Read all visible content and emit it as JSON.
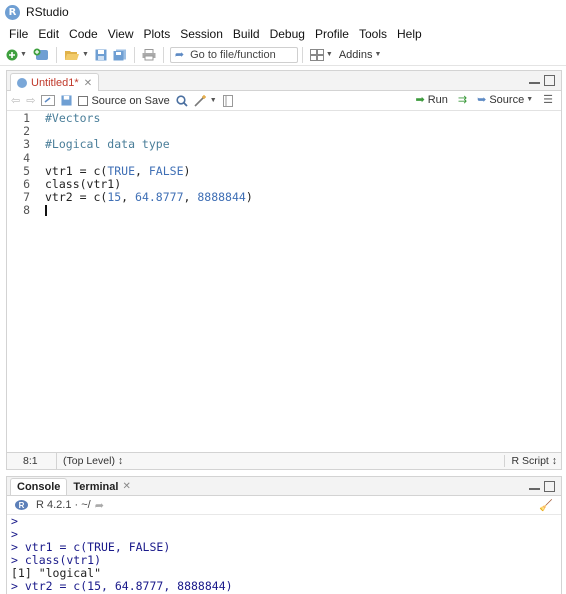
{
  "window": {
    "title": "RStudio",
    "logo_letter": "R"
  },
  "menu": [
    "File",
    "Edit",
    "Code",
    "View",
    "Plots",
    "Session",
    "Build",
    "Debug",
    "Profile",
    "Tools",
    "Help"
  ],
  "toolbar": {
    "goto_placeholder": "Go to file/function",
    "addins_label": "Addins"
  },
  "editor": {
    "tab_label": "Untitled1*",
    "source_on_save_label": "Source on Save",
    "run_label": "Run",
    "source_label": "Source",
    "lines": [
      {
        "num": "1",
        "text": "#Vectors"
      },
      {
        "num": "2",
        "text": ""
      },
      {
        "num": "3",
        "text": "#Logical data type"
      },
      {
        "num": "4",
        "text": ""
      },
      {
        "num": "5",
        "text": "vtr1 = c(TRUE, FALSE)"
      },
      {
        "num": "6",
        "text": "class(vtr1)"
      },
      {
        "num": "7",
        "text": "vtr2 = c(15, 64.8777, 8888844)"
      },
      {
        "num": "8",
        "text": ""
      }
    ],
    "status": {
      "position": "8:1",
      "scope": "(Top Level) ↕",
      "file_type": "R Script ↕"
    }
  },
  "console": {
    "tabs": [
      {
        "label": "Console"
      },
      {
        "label": "Terminal"
      }
    ],
    "r_version": "R 4.2.1 · ~/",
    "lines": [
      {
        "text": ">",
        "kind": "prompt"
      },
      {
        "text": ">",
        "kind": "prompt"
      },
      {
        "text": "> vtr1 = c(TRUE, FALSE)",
        "kind": "prompt"
      },
      {
        "text": "> class(vtr1)",
        "kind": "prompt"
      },
      {
        "text": "[1] \"logical\"",
        "kind": "output"
      },
      {
        "text": "> vtr2 = c(15, 64.8777, 8888844)",
        "kind": "prompt"
      }
    ]
  },
  "colors": {
    "comment": "#4a7e99",
    "keyword": "#3f6fb5",
    "console_input": "#1a1a8a",
    "tab_modified": "#c0392b"
  }
}
